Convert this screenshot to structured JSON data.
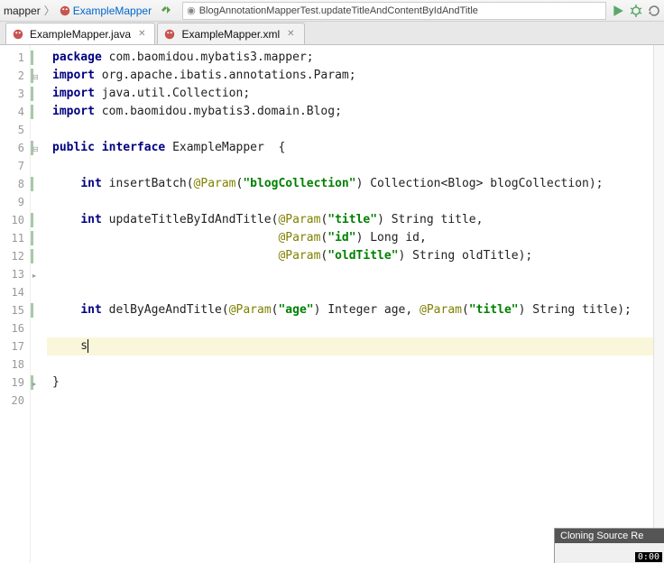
{
  "nav": {
    "crumb1": "mapper",
    "crumb2": "ExampleMapper",
    "runConfig": "BlogAnnotationMapperTest.updateTitleAndContentByIdAndTitle"
  },
  "tabs": [
    {
      "label": "ExampleMapper.java",
      "active": true
    },
    {
      "label": "ExampleMapper.xml",
      "active": false
    }
  ],
  "code": {
    "lines": [
      {
        "n": 1,
        "bug": false,
        "bar": true,
        "html": "<span class='kw'>package</span> com.baomidou.mybatis3.mapper;"
      },
      {
        "n": 2,
        "bug": false,
        "bar": true,
        "fold": "⊟",
        "html": "<span class='kw'>import</span> org.apache.ibatis.annotations.Param;"
      },
      {
        "n": 3,
        "bug": false,
        "bar": true,
        "html": "<span class='kw'>import</span> java.util.Collection;"
      },
      {
        "n": 4,
        "bug": false,
        "bar": true,
        "html": "<span class='kw'>import</span> com.baomidou.mybatis3.domain.Blog;"
      },
      {
        "n": 5,
        "bug": false,
        "bar": false,
        "html": ""
      },
      {
        "n": 6,
        "bug": true,
        "bar": true,
        "fold": "⊟",
        "html": "<span class='kw'>public</span> <span class='kw'>interface</span> ExampleMapper  {"
      },
      {
        "n": 7,
        "bug": false,
        "bar": false,
        "html": ""
      },
      {
        "n": 8,
        "bug": true,
        "bar": true,
        "html": "    <span class='kw'>int</span> insertBatch(<span class='ann'>@Param</span>(<span class='str'>\"blogCollection\"</span>) Collection&lt;Blog&gt; blogCollection);"
      },
      {
        "n": 9,
        "bug": false,
        "bar": false,
        "html": ""
      },
      {
        "n": 10,
        "bug": true,
        "bar": true,
        "html": "    <span class='kw'>int</span> updateTitleByIdAndTitle(<span class='ann'>@Param</span>(<span class='str'>\"title\"</span>) String title,"
      },
      {
        "n": 11,
        "bug": false,
        "bar": true,
        "html": "                                <span class='ann'>@Param</span>(<span class='str'>\"id\"</span>) Long id,"
      },
      {
        "n": 12,
        "bug": false,
        "bar": true,
        "html": "                                <span class='ann'>@Param</span>(<span class='str'>\"oldTitle\"</span>) String oldTitle);"
      },
      {
        "n": 13,
        "bug": false,
        "bar": false,
        "fold": "▸",
        "html": ""
      },
      {
        "n": 14,
        "bug": false,
        "bar": false,
        "html": ""
      },
      {
        "n": 15,
        "bug": true,
        "bar": true,
        "html": "    <span class='kw'>int</span> delByAgeAndTitle(<span class='ann'>@Param</span>(<span class='str'>\"age\"</span>) Integer age, <span class='ann'>@Param</span>(<span class='str'>\"title\"</span>) String title);"
      },
      {
        "n": 16,
        "bug": false,
        "bar": false,
        "html": ""
      },
      {
        "n": 17,
        "bug": false,
        "bar": false,
        "hl": true,
        "html": "    s<span class='cursor'></span>"
      },
      {
        "n": 18,
        "bug": false,
        "bar": false,
        "html": ""
      },
      {
        "n": 19,
        "bug": false,
        "bar": true,
        "fold": "▸",
        "html": "}"
      },
      {
        "n": 20,
        "bug": false,
        "bar": false,
        "html": ""
      }
    ]
  },
  "popup": {
    "title": "Cloning Source Re",
    "timer": "0:00"
  }
}
